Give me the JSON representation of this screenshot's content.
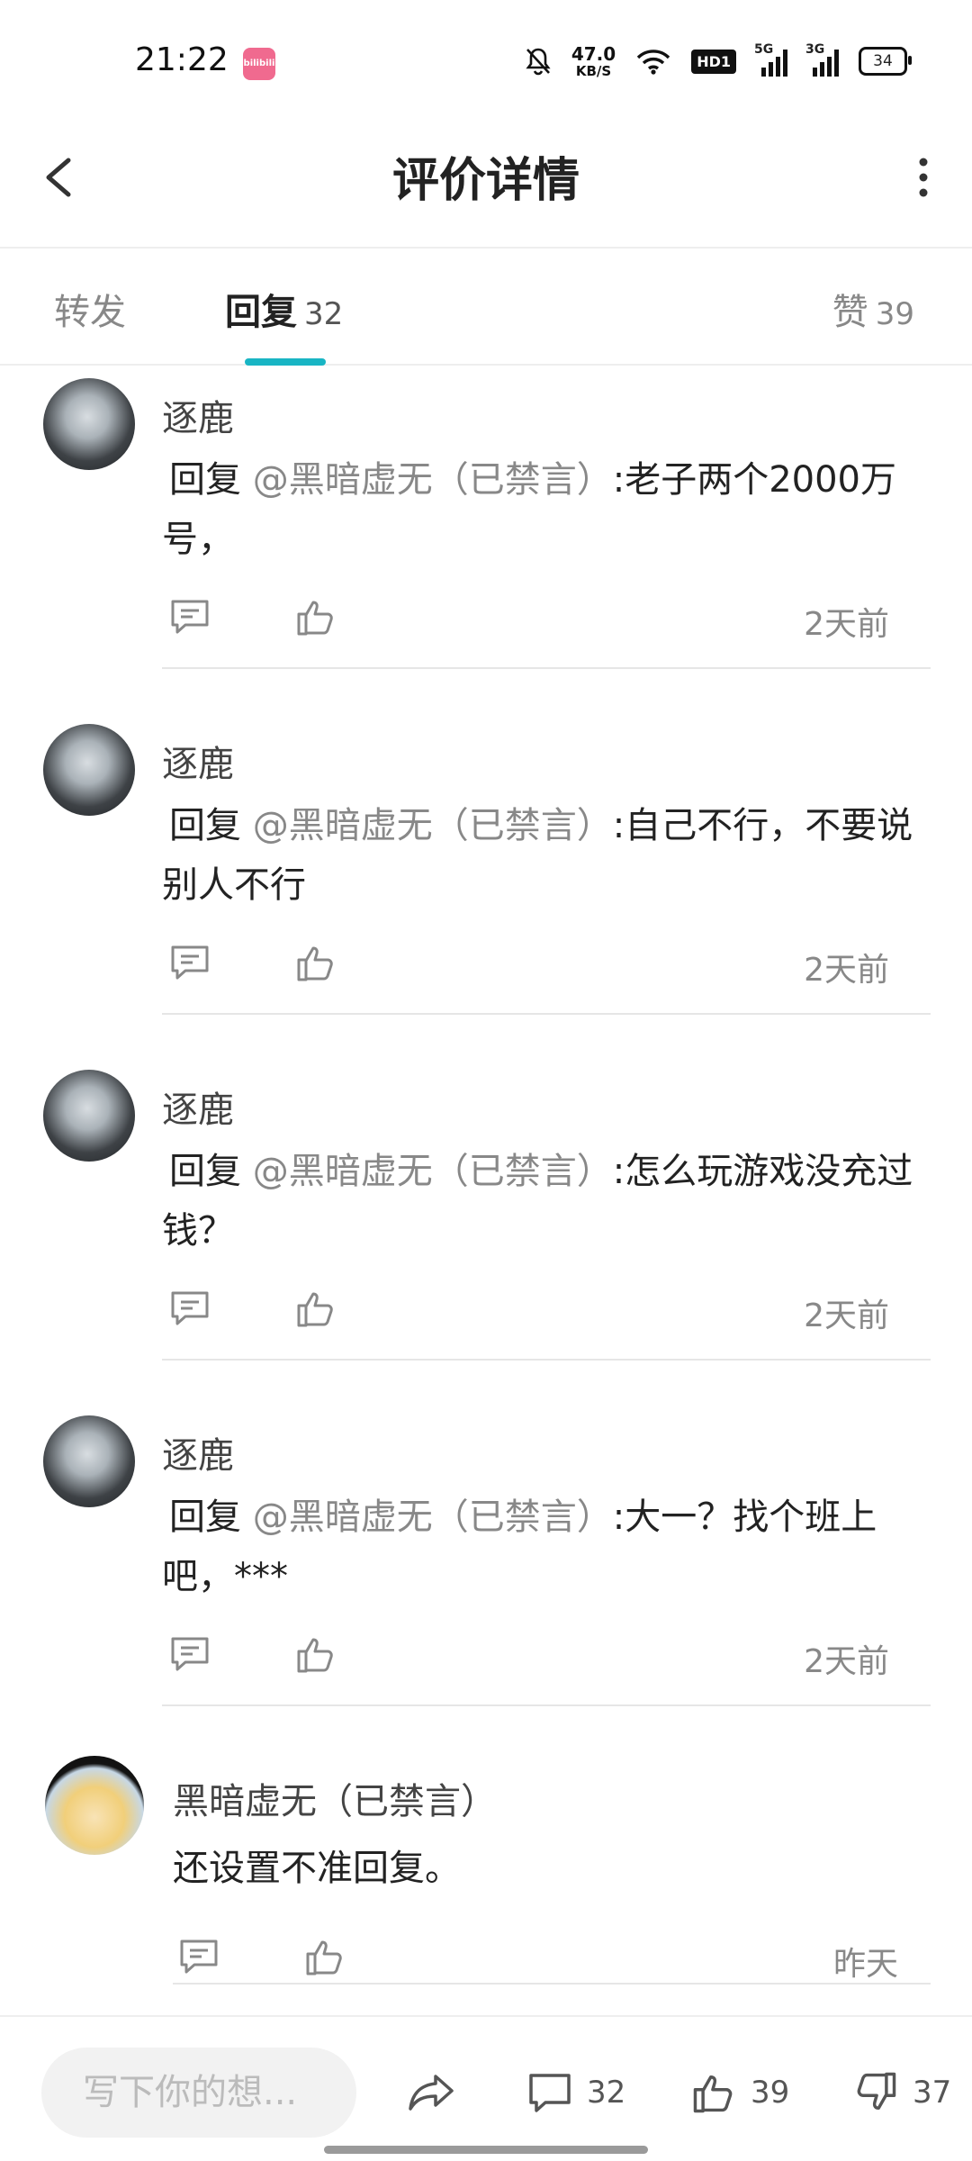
{
  "status_bar": {
    "time": "21:22",
    "app_badge": "bilibili",
    "net_speed_value": "47.0",
    "net_speed_unit": "KB/S",
    "hd_badge": "HD1",
    "signal1_label": "5G",
    "signal2_label": "3G",
    "battery": "34"
  },
  "header": {
    "title": "评价详情"
  },
  "tabs": {
    "forward_label": "转发",
    "reply_label": "回复",
    "reply_count": "32",
    "like_label": "赞",
    "like_count": "39"
  },
  "comments": [
    {
      "author": "逐鹿",
      "reply_prefix": "回复",
      "mention": "@黑暗虚无（已禁言）",
      "text": ":老子两个2000万号，",
      "time": "2天前"
    },
    {
      "author": "逐鹿",
      "reply_prefix": "回复",
      "mention": "@黑暗虚无（已禁言）",
      "text": ":自己不行，不要说别人不行",
      "time": "2天前"
    },
    {
      "author": "逐鹿",
      "reply_prefix": "回复",
      "mention": "@黑暗虚无（已禁言）",
      "text": ":怎么玩游戏没充过钱？",
      "time": "2天前"
    },
    {
      "author": "逐鹿",
      "reply_prefix": "回复",
      "mention": "@黑暗虚无（已禁言）",
      "text": ":大一？找个班上吧，***",
      "time": "2天前"
    },
    {
      "author": "黑暗虚无（已禁言）",
      "text": "还设置不准回复。",
      "time": "昨天"
    }
  ],
  "bottom_bar": {
    "input_placeholder": "写下你的想...",
    "comment_count": "32",
    "like_count": "39",
    "dislike_count": "37"
  },
  "colors": {
    "accent": "#18b5c4",
    "mention": "#888888"
  }
}
